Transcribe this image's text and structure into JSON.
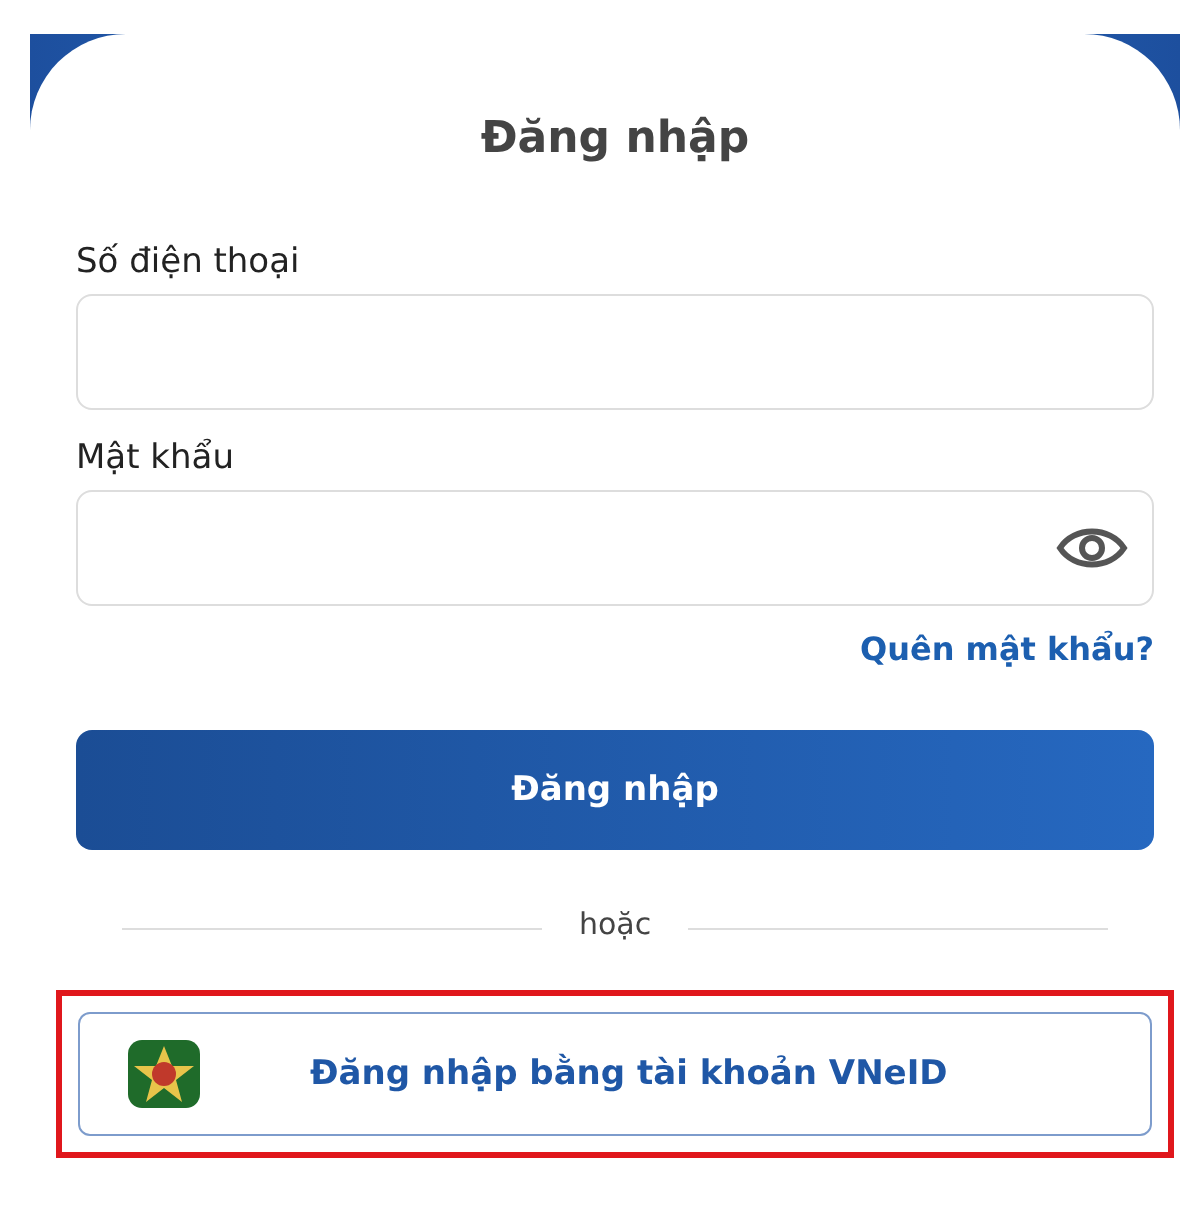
{
  "title": "Đăng nhập",
  "fields": [
    {
      "label": "Số điện thoại",
      "kind": "text"
    },
    {
      "label": "Mật khẩu",
      "kind": "password"
    }
  ],
  "forgot_link": "Quên mật khẩu?",
  "login_button": "Đăng nhập",
  "divider_text": "hoặc",
  "vneid_button": {
    "label": "Đăng nhập bằng tài khoản VNeID",
    "highlighted": true
  }
}
